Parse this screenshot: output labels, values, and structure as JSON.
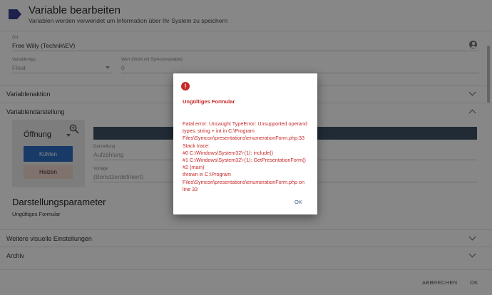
{
  "header": {
    "title": "Variable bearbeiten",
    "subtitle": "Variablen werden verwendet um Information über Ihr System zu speichern",
    "icon": "variable-tag-icon",
    "accent": "#3a3f8f"
  },
  "fields": {
    "location_label": "Ort",
    "location_value": "Free Willy (Technik\\EV)",
    "type_label": "Variablentyp",
    "type_value": "Float",
    "value_label": "Wert (Nicht mit Symconvariable)",
    "value_value": "0"
  },
  "sections": {
    "action": "Variablenaktion",
    "display": "Variablendarstellung",
    "visual": "Weitere visuelle Einstellungen",
    "archive": "Archiv"
  },
  "display": {
    "preview_label": "Öffnung",
    "cool_button": "Kühlen",
    "heat_button": "Heizen",
    "presentation_label": "Darstellung",
    "presentation_value": "Aufzählung",
    "template_label": "Vorlage",
    "template_value": "(Benutzerdefiniert)",
    "params_title": "Darstellungsparameter",
    "params_error": "Ungültiges Formular"
  },
  "footer": {
    "cancel": "ABBRECHEN",
    "ok": "OK"
  },
  "dialog": {
    "title": "Ungültiges Formular",
    "message": "Fatal error: Uncaught TypeError: Unsupported operand types: string + int in C:\\Program Files\\Symcon\\presentations\\enumerationForm.php:33\nStack trace:\n#0 C:\\Windows\\System32\\-(1): include()\n#1 C:\\Windows\\System32\\-(1): GetPresentationForm()\n#2 {main}\n  thrown in C:\\Program Files\\Symcon\\presentations\\enumerationForm.php on line 33",
    "ok": "OK",
    "error_color": "#c62828"
  }
}
